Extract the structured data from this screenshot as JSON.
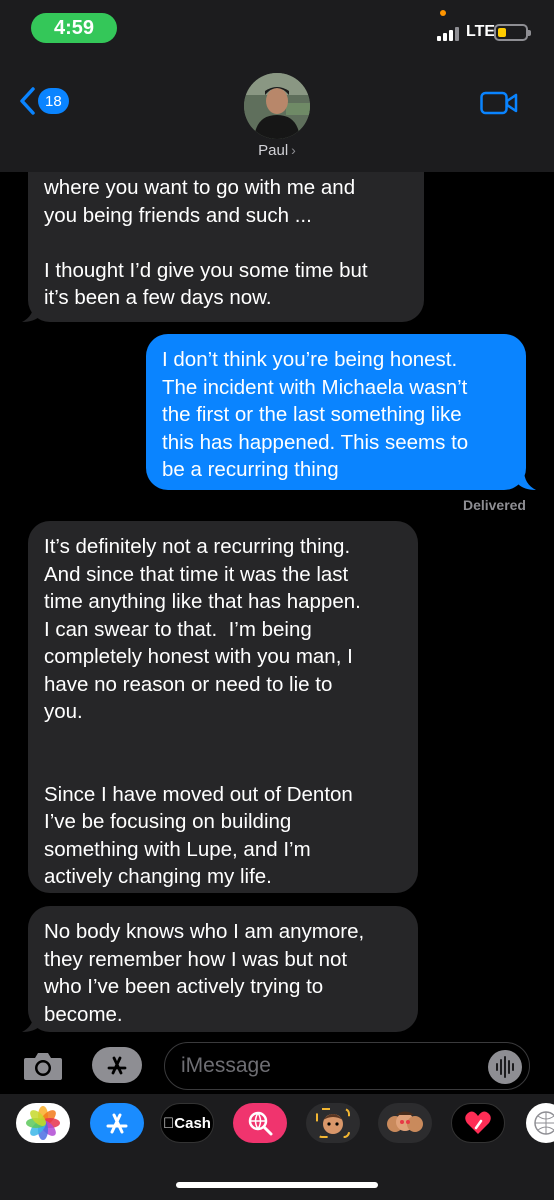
{
  "status_bar": {
    "time": "4:59",
    "network": "LTE"
  },
  "header": {
    "back_badge": "18",
    "contact_name": "Paul",
    "contact_chevron": "›"
  },
  "messages": [
    {
      "from": "them",
      "text": "where you want to go with me and\nyou being friends and such ...\n\nI thought I’d give you some time but\nit’s been a few days now."
    },
    {
      "from": "me",
      "text": "I don’t think you’re being honest.\nThe incident with Michaela wasn’t\nthe first or the last something like\nthis has happened. This seems to\nbe a recurring thing"
    },
    {
      "from": "them",
      "text": "It’s definitely not a recurring thing.\nAnd since that time it was the last\ntime anything like that has happen.\nI can swear to that.  I’m being\ncompletely honest with you man, I\nhave no reason or need to lie to\nyou.\n\n\nSince I have moved out of Denton\nI’ve be focusing on building\nsomething with Lupe, and I’m\nactively changing my life."
    },
    {
      "from": "them",
      "text": "No body knows who I am anymore,\nthey remember how I was but not\nwho I’ve been actively trying to\nbecome."
    }
  ],
  "delivery_status": "Delivered",
  "compose": {
    "placeholder": "iMessage"
  },
  "app_drawer": [
    {
      "icon": "photos-icon"
    },
    {
      "icon": "app-store-icon"
    },
    {
      "icon": "apple-cash-icon",
      "label": "Cash"
    },
    {
      "icon": "web-search-icon"
    },
    {
      "icon": "animoji-icon"
    },
    {
      "icon": "memoji-stickers-icon"
    },
    {
      "icon": "digital-touch-icon"
    },
    {
      "icon": "more-apps-icon"
    }
  ],
  "colors": {
    "sent_bubble": "#0a84ff",
    "received_bubble": "#262628",
    "time_pill": "#34c759",
    "header_bg": "#1c1c1e"
  }
}
